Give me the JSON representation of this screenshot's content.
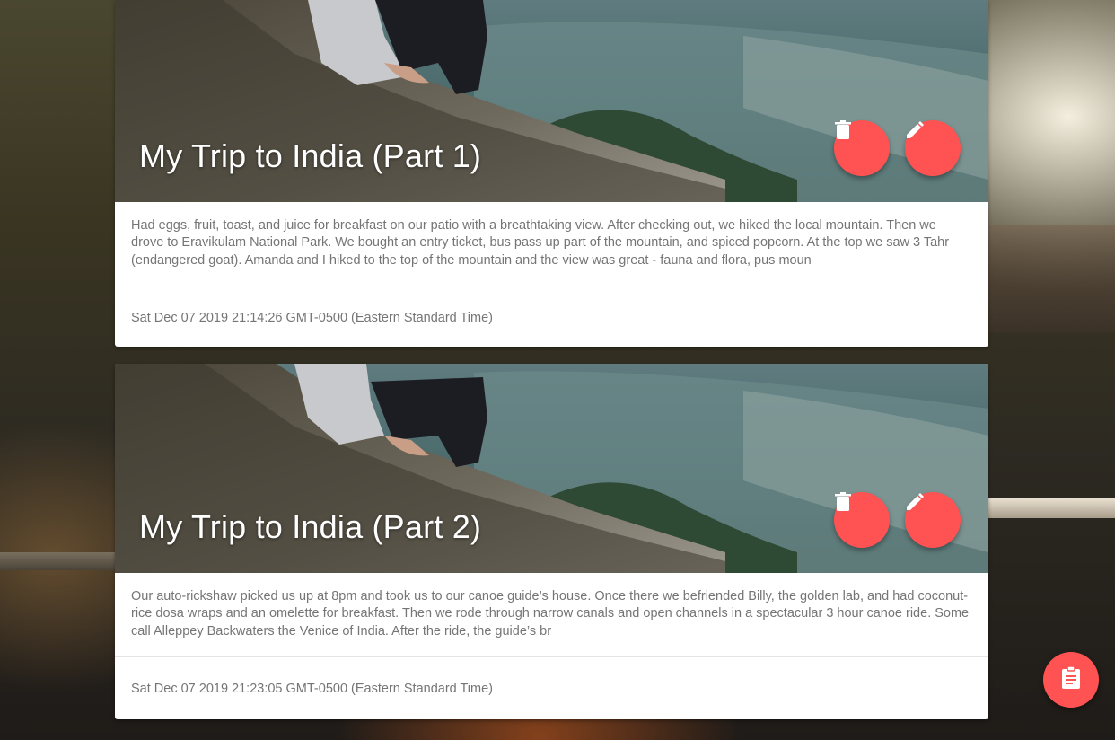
{
  "posts": [
    {
      "title": "My Trip to India (Part 1)",
      "excerpt": "Had eggs, fruit, toast, and juice for breakfast on our patio with a breathtaking view. After checking out, we hiked the local mountain. Then we drove to Eravikulam National Park. We bought an entry ticket, bus pass up part of the mountain, and spiced popcorn. At the top we saw 3 Tahr (endangered goat). Amanda and I hiked to the top of the mountain and the view was great - fauna and flora, pus moun",
      "timestamp": "Sat Dec 07 2019 21:14:26 GMT-0500 (Eastern Standard Time)",
      "delete_icon": "trash-icon",
      "edit_icon": "pencil-icon"
    },
    {
      "title": "My Trip to India (Part 2)",
      "excerpt": "Our auto-rickshaw picked us up at 8pm and took us to our canoe guide’s house. Once there we befriended Billy, the golden lab, and had coconut-rice dosa wraps and an omelette for breakfast. Then we rode through narrow canals and open channels in a spectacular 3 hour canoe ride. Some call Alleppey Backwaters the Venice of India. After the ride, the guide’s br",
      "timestamp": "Sat Dec 07 2019 21:23:05 GMT-0500 (Eastern Standard Time)",
      "delete_icon": "trash-icon",
      "edit_icon": "pencil-icon"
    }
  ],
  "fab": {
    "icon": "clipboard-icon"
  },
  "colors": {
    "accent": "#ff5252",
    "text_muted": "#757575",
    "card_bg": "#ffffff"
  }
}
